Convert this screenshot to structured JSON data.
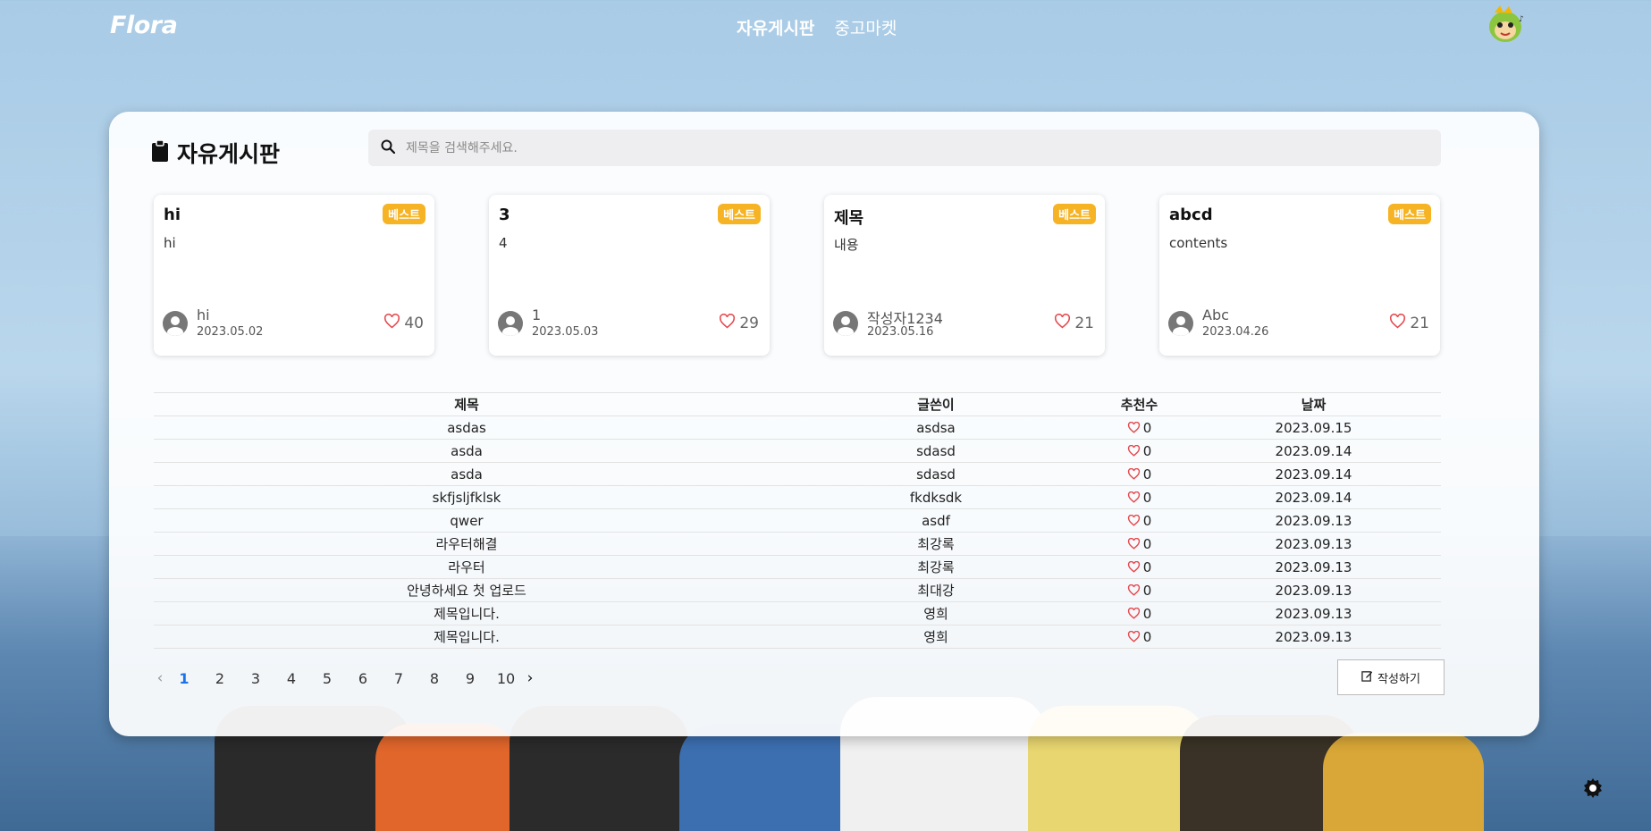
{
  "nav": {
    "logo": "Flora",
    "links": [
      "자유게시판",
      "중고마켓"
    ],
    "active_index": 0
  },
  "board": {
    "title": "자유게시판",
    "search_placeholder": "제목을 검색해주세요."
  },
  "best_badge": "베스트",
  "best_posts": [
    {
      "title": "hi",
      "content": "hi",
      "author": "hi",
      "date": "2023.05.02",
      "likes": "40"
    },
    {
      "title": "3",
      "content": "4",
      "author": "1",
      "date": "2023.05.03",
      "likes": "29"
    },
    {
      "title": "제목",
      "content": "내용",
      "author": "작성자1234",
      "date": "2023.05.16",
      "likes": "21"
    },
    {
      "title": "abcd",
      "content": "contents",
      "author": "Abc",
      "date": "2023.04.26",
      "likes": "21"
    }
  ],
  "table": {
    "headers": [
      "제목",
      "글쓴이",
      "추천수",
      "날짜"
    ],
    "rows": [
      {
        "title": "asdas",
        "writer": "asdsa",
        "likes": "0",
        "date": "2023.09.15"
      },
      {
        "title": "asda",
        "writer": "sdasd",
        "likes": "0",
        "date": "2023.09.14"
      },
      {
        "title": "asda",
        "writer": "sdasd",
        "likes": "0",
        "date": "2023.09.14"
      },
      {
        "title": "skfjsljfklsk",
        "writer": "fkdksdk",
        "likes": "0",
        "date": "2023.09.14"
      },
      {
        "title": "qwer",
        "writer": "asdf",
        "likes": "0",
        "date": "2023.09.13"
      },
      {
        "title": "라우터해결",
        "writer": "최강록",
        "likes": "0",
        "date": "2023.09.13"
      },
      {
        "title": "라우터",
        "writer": "최강록",
        "likes": "0",
        "date": "2023.09.13"
      },
      {
        "title": "안녕하세요 첫 업로드",
        "writer": "최대강",
        "likes": "0",
        "date": "2023.09.13"
      },
      {
        "title": "제목입니다.",
        "writer": "영희",
        "likes": "0",
        "date": "2023.09.13"
      },
      {
        "title": "제목입니다.",
        "writer": "영희",
        "likes": "0",
        "date": "2023.09.13"
      }
    ]
  },
  "pagination": {
    "prev": "‹",
    "next": "›",
    "pages": [
      "1",
      "2",
      "3",
      "4",
      "5",
      "6",
      "7",
      "8",
      "9",
      "10"
    ],
    "current": "1"
  },
  "write_button": "작성하기",
  "colors": {
    "accent": "#1a73e8",
    "badge": "#f6b323",
    "heart": "#e5484d"
  },
  "icons": {
    "board": "clipboard-icon",
    "search": "search-icon",
    "heart": "heart-icon",
    "user": "user-icon",
    "write": "edit-icon",
    "settings": "gear-icon"
  }
}
